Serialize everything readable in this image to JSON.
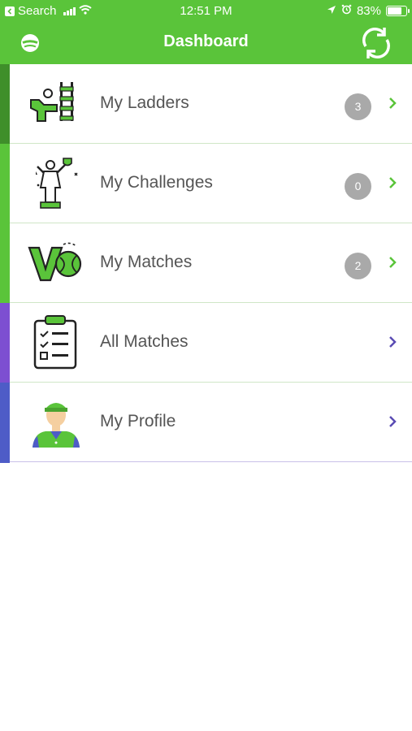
{
  "status_bar": {
    "back_label": "Search",
    "time": "12:51 PM",
    "battery": "83%",
    "battery_level": 0.83
  },
  "header": {
    "title": "Dashboard",
    "logo_icon": "app-logo-icon",
    "refresh_icon": "refresh-icon"
  },
  "colors": {
    "brand_green": "#5ac43a",
    "stripe_dark_green": "#3f8f2a",
    "stripe_green": "#5ac43a",
    "stripe_purple": "#7d4fd1",
    "stripe_blue": "#4e5cc7",
    "badge_gray": "#a9a9a9"
  },
  "menu": [
    {
      "label": "My Ladders",
      "badge": "3",
      "icon": "ladder-icon"
    },
    {
      "label": "My Challenges",
      "badge": "0",
      "icon": "trophy-winner-icon"
    },
    {
      "label": "My Matches",
      "badge": "2",
      "icon": "versus-icon"
    },
    {
      "label": "All Matches",
      "icon": "clipboard-checklist-icon"
    },
    {
      "label": "My Profile",
      "icon": "player-avatar-icon"
    }
  ]
}
